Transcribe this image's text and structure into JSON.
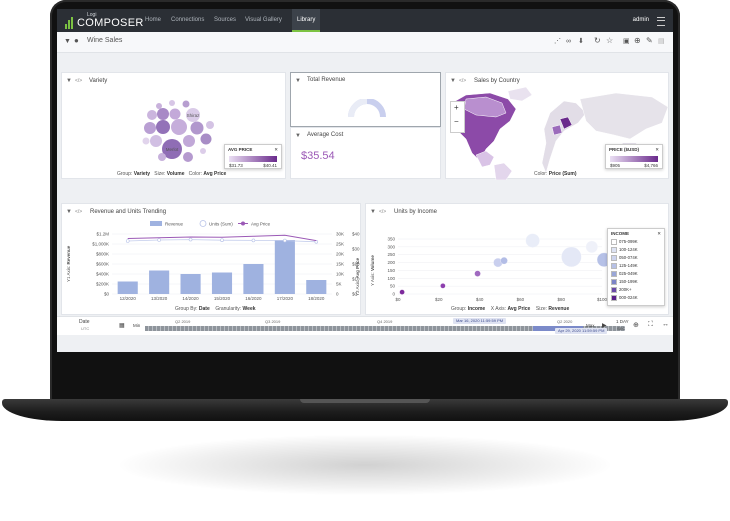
{
  "app": {
    "logo_small": "Logi",
    "logo_big": "COMPOSER",
    "nav": [
      "Home",
      "Connections",
      "Sources",
      "Visual Gallery",
      "Library"
    ],
    "active_nav": "Library",
    "user": "admin"
  },
  "dashboard": {
    "title": "Wine Sales",
    "toolbar_icons": [
      "share-icon",
      "link-icon",
      "download-icon",
      "refresh-icon",
      "star-icon",
      "trash-icon",
      "add-icon",
      "edit-icon",
      "print-icon"
    ]
  },
  "variety": {
    "title": "Variety",
    "bubbles": [
      "Shiraz",
      "Merlot"
    ],
    "legend_title": "AVG PRICE",
    "legend_min": "$31.73",
    "legend_max": "$40.41",
    "footer_labels": [
      "Group:",
      "Size:",
      "Color:"
    ],
    "footer_values": [
      "Variety",
      "Volume",
      "Avg Price"
    ]
  },
  "total_revenue": {
    "title": "Total Revenue"
  },
  "average_cost": {
    "title": "Average Cost",
    "value": "$35.54"
  },
  "sales_by_country": {
    "title": "Sales by Country",
    "legend_title": "PRICE ($USD)",
    "legend_min": "$905",
    "legend_max": "$4,766",
    "footer_label": "Color:",
    "footer_value": "Price (Sum)",
    "zoom_in": "+",
    "zoom_out": "−"
  },
  "trending": {
    "title": "Revenue and Units Trending",
    "legend": [
      "Revenue",
      "Units (Sum)",
      "Avg Price"
    ],
    "y_left_title": "Y1 Axis:",
    "y_left_value": "Revenue",
    "y_right_title": "Y3 Axis:",
    "y_right_value": "Avg Price",
    "footer_labels": [
      "Group By:",
      "Granularity:"
    ],
    "footer_values": [
      "Date",
      "Week"
    ]
  },
  "units_income": {
    "title": "Units by Income",
    "y_title": "Y Axis:",
    "y_value": "Volume",
    "legend_title": "INCOME",
    "legend_items": [
      "075-099K",
      "100-124K",
      "050-074K",
      "125-149K",
      "025-049K",
      "150-199K",
      "200K+",
      "000-024K"
    ],
    "legend_colors": [
      "#ffffff",
      "#dde3f4",
      "#cdd4ee",
      "#b7c1e6",
      "#9aa7d8",
      "#7c84c7",
      "#6a4aa8",
      "#5a1f8a"
    ],
    "footer_labels": [
      "Group:",
      "X Axis:",
      "Size:"
    ],
    "footer_values": [
      "Income",
      "Avg Price",
      "Revenue"
    ]
  },
  "timeline": {
    "label": "Date",
    "tz": "UTC",
    "min_label": "Min",
    "max_label": "Max",
    "quarters": [
      "Q2 2019",
      "Q3 2019",
      "Q4 2019",
      "Q2 2020"
    ],
    "start_tag": "Mar 16, 2020 11:59:59 PM",
    "end_tag": "Apr 29, 2020 11:59:59 PM",
    "step": "1 DAY",
    "step_sub": "SEC"
  },
  "chart_data": [
    {
      "type": "bar",
      "title": "Revenue and Units Trending",
      "categories": [
        "12/2020",
        "13/2020",
        "14/2020",
        "15/2020",
        "16/2020",
        "17/2020",
        "18/2020"
      ],
      "series": [
        {
          "name": "Revenue",
          "type": "bar",
          "values": [
            250000,
            470000,
            400000,
            430000,
            600000,
            1080000,
            280000
          ]
        },
        {
          "name": "Units (Sum)",
          "type": "line",
          "values": [
            26500,
            27000,
            27200,
            26900,
            26800,
            26700,
            26100
          ]
        },
        {
          "name": "Avg Price",
          "type": "line",
          "values": [
            37,
            37.5,
            38,
            37.8,
            38.5,
            39.2,
            35.6
          ]
        }
      ],
      "y_left_ticks": [
        "$1.2M",
        "$1,000K",
        "$800K",
        "$600K",
        "$400K",
        "$200K",
        "$0"
      ],
      "y_mid_ticks": [
        "30K",
        "25K",
        "20K",
        "15K",
        "10K",
        "5K",
        "0"
      ],
      "y_right_ticks": [
        "$40",
        "$30",
        "$20",
        "$10",
        "$0"
      ],
      "ylim": [
        0,
        1200000
      ]
    },
    {
      "type": "scatter",
      "title": "Units by Income",
      "x_ticks": [
        "$0",
        "$20",
        "$40",
        "$60",
        "$80",
        "$100"
      ],
      "y_ticks": [
        "350",
        "300",
        "250",
        "200",
        "150",
        "100",
        "50",
        "0"
      ],
      "xlim": [
        0,
        100
      ],
      "ylim": [
        0,
        350
      ],
      "points": [
        {
          "x": 2,
          "y": 12,
          "r": 2.5,
          "c": "#7d2a9c"
        },
        {
          "x": 22,
          "y": 52,
          "r": 2.5,
          "c": "#8d3fae"
        },
        {
          "x": 39,
          "y": 130,
          "r": 3,
          "c": "#a06ac0"
        },
        {
          "x": 49,
          "y": 200,
          "r": 4.5,
          "c": "#c9cfee"
        },
        {
          "x": 66,
          "y": 340,
          "r": 7,
          "c": "#e9edf8"
        },
        {
          "x": 95,
          "y": 300,
          "r": 6,
          "c": "#eff1f9"
        },
        {
          "x": 85,
          "y": 236,
          "r": 10,
          "c": "#e4e8f6"
        },
        {
          "x": 101,
          "y": 218,
          "r": 7,
          "c": "#b6c1e7"
        },
        {
          "x": 52,
          "y": 212,
          "r": 3.5,
          "c": "#b3bde6"
        }
      ]
    }
  ]
}
